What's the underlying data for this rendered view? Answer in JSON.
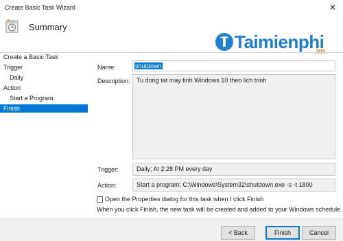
{
  "window": {
    "title": "Create Basic Task Wizard",
    "close_glyph": "✕"
  },
  "header": {
    "title": "Summary"
  },
  "watermark": {
    "brand": "Taimienphi",
    "tld": ".vn"
  },
  "sidebar": {
    "items": [
      {
        "label": "Create a Basic Task"
      },
      {
        "label": "Trigger"
      },
      {
        "label": "Daily"
      },
      {
        "label": "Action"
      },
      {
        "label": "Start a Program"
      },
      {
        "label": "Finish"
      }
    ]
  },
  "form": {
    "name_label": "Name:",
    "name_value": "shutdown",
    "description_label": "Description:",
    "description_value": "Tu dong tat may tinh Windows 10 theo lich trinh",
    "trigger_label": "Trigger:",
    "trigger_value": "Daily; At 2:28 PM every day",
    "action_label": "Action:",
    "action_value": "Start a program; C:\\Windows\\System32\\shutdown.exe -s -t 1800"
  },
  "checkbox": {
    "label": "Open the Properties dialog for this task when I click Finish",
    "checked": false
  },
  "note": "When you click Finish, the new task will be created and added to your Windows schedule.",
  "buttons": {
    "back": "< Back",
    "finish": "Finish",
    "cancel": "Cancel"
  }
}
